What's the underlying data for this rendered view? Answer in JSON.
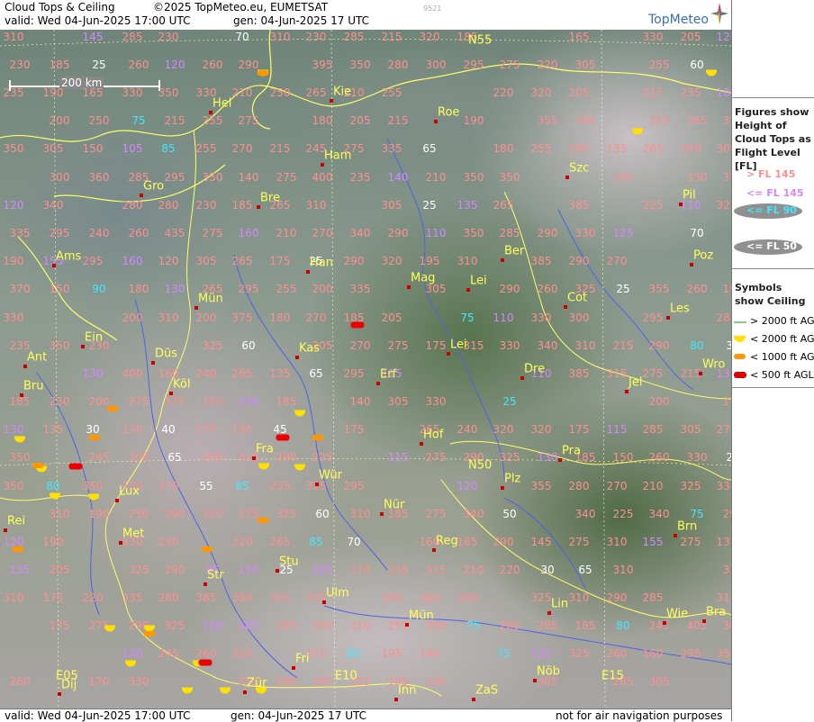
{
  "header": {
    "title": "Cloud Tops & Ceiling",
    "copyright": "©2025 TopMeteo.eu, EUMETSAT",
    "valid": "valid:  Wed  04-Jun-2025  17:00 UTC",
    "gen": "gen: 04-Jun-2025 17 UTC",
    "code": "9521",
    "logo": "TopMeteo"
  },
  "scale_label": "200 km",
  "footer": {
    "valid": "valid:  Wed  04-Jun-2025  17:00 UTC",
    "gen": "gen: 04-Jun-2025 17 UTC",
    "disclaimer": "not for air navigation purposes"
  },
  "legend": {
    "clouds_heading": "Figures show Height of Cloud Tops as Flight Level  [FL]",
    "fl_items": [
      {
        "label": "> FL 145",
        "color": "#ff8f8f",
        "bg": ""
      },
      {
        "label": "<= FL 145",
        "color": "#d586ff",
        "bg": ""
      },
      {
        "label": "<= FL 90",
        "color": "#3fe8ff",
        "bg": "#909090"
      },
      {
        "label": "<= FL 70",
        "color": "#ffffff",
        "bg": ""
      },
      {
        "label": "<= FL 50",
        "color": "#ffffff",
        "bg": "#909090"
      }
    ],
    "symbols_heading": "Symbols show Ceiling",
    "ceiling_items": [
      {
        "label": "> 2000 ft AGL",
        "symbol": "line",
        "color": "#7fd07f"
      },
      {
        "label": "< 2000 ft AGL",
        "symbol": "yellow",
        "color": "#ffe000"
      },
      {
        "label": "< 1000 ft AGL",
        "symbol": "orange",
        "color": "#ff9800"
      },
      {
        "label": "< 500 ft AGL",
        "symbol": "red",
        "color": "#e00000"
      }
    ]
  },
  "grid_labels": [
    "E05",
    "E10",
    "E15",
    "N50",
    "N55"
  ],
  "cities": [
    "Kie",
    "Hel",
    "Ham",
    "Gro",
    "Bre",
    "Ams",
    "Han",
    "Ber",
    "Szc",
    "Pil",
    "Mag",
    "Lei",
    "Poz",
    "Mün",
    "Cot",
    "Les",
    "Ein",
    "Kas",
    "Ant",
    "Düs",
    "Lei",
    "Bru",
    "Köl",
    "Erf",
    "Dre",
    "Wro",
    "Jel",
    "Fra",
    "Hof",
    "Pra",
    "Lux",
    "Wür",
    "Plz",
    "Rei",
    "Met",
    "Nür",
    "Reg",
    "Brn",
    "Stu",
    "Str",
    "Ulm",
    "Lin",
    "Mün",
    "Wie",
    "Bra",
    "Fri",
    "Nöb",
    "Dij",
    "Inn",
    "Zür",
    "ZaS",
    "Roe"
  ],
  "cloud_tops": {
    "pink": [
      "305",
      "325",
      "200",
      "250",
      "185",
      "290",
      "205",
      "255",
      "165",
      "150",
      "310",
      "385",
      "405",
      "265",
      "200",
      "175",
      "180",
      "295",
      "160",
      "250",
      "195",
      "150",
      "175",
      "150",
      "170",
      "275",
      "165",
      "230",
      "195",
      "190",
      "315",
      "265",
      "205",
      "200",
      "235",
      "230",
      "385",
      "435",
      "195",
      "150",
      "135",
      "265",
      "185",
      "225",
      "275",
      "280",
      "290",
      "210",
      "195",
      "190",
      "140",
      "160",
      "200",
      "235",
      "200",
      "220",
      "325",
      "190",
      "185",
      "190",
      "145",
      "245",
      "200",
      "235",
      "320",
      "170",
      "140",
      "185",
      "230",
      "215",
      "185",
      "260",
      "200",
      "195",
      "295",
      "330",
      "235",
      "120",
      "205",
      "245",
      "245",
      "185",
      "105",
      "210",
      "290",
      "260",
      "295",
      "320",
      "275",
      "185",
      "170",
      "235",
      "215",
      "210",
      "260",
      "305",
      "255",
      "305",
      "360",
      "350",
      "245",
      "175",
      "165",
      "170",
      "135",
      "185",
      "205",
      "180",
      "215",
      "270",
      "275",
      "305",
      "290",
      "325",
      "350",
      "200",
      "160",
      "190",
      "255",
      "245",
      "265",
      "270",
      "310",
      "375",
      "350",
      "395",
      "185",
      "210",
      "225",
      "240",
      "265",
      "275",
      "215",
      "210",
      "245",
      "240",
      "260",
      "255",
      "350",
      "350",
      "350",
      "225",
      "270",
      "270",
      "290",
      "260",
      "275",
      "225",
      "285",
      "260",
      "285",
      "310",
      "290",
      "305",
      "305",
      "325",
      "360",
      "350",
      "230",
      "275",
      "280",
      "290",
      "295",
      "260",
      "325",
      "275",
      "295",
      "315",
      "355",
      "385",
      "400",
      "180",
      "230",
      "275",
      "285",
      "290",
      "275",
      "280",
      "295",
      "260",
      "325",
      "275",
      "295",
      "315",
      "355",
      "385",
      "400",
      "230",
      "180",
      "195",
      "265",
      "285",
      "265",
      "290",
      "305",
      "295",
      "215",
      "280",
      "310",
      "310",
      "340",
      "330",
      "235",
      "190",
      "175",
      "255",
      "240",
      "290",
      "265",
      "275",
      "285",
      "290",
      "295",
      "280",
      "290",
      "310",
      "330",
      "330",
      "325",
      "135",
      "185",
      "290",
      "290",
      "290",
      "275",
      "290",
      "310",
      "325",
      "330",
      "310",
      "330",
      "350",
      "350",
      "350",
      "310",
      "175",
      "135",
      "210",
      "295",
      "305",
      "340",
      "320",
      "325",
      "350",
      "310",
      "340",
      "330",
      "350",
      "355",
      "340",
      "265",
      "175",
      "275",
      "215",
      "310",
      "305",
      "300",
      "325",
      "350",
      "310",
      "305",
      "355",
      "330",
      "375",
      "370",
      "220",
      "205",
      "205",
      "280",
      "215",
      "310",
      "275",
      "350",
      "375",
      "340",
      "325",
      "320",
      "320",
      "335",
      "330",
      "255",
      "220",
      "270",
      "235",
      "315",
      "285",
      "265",
      "305",
      "340",
      "325",
      "320",
      "335",
      "330",
      "310",
      "350",
      "330",
      "220",
      "255",
      "260",
      "225",
      "280",
      "350",
      "310",
      "275",
      "330",
      "310",
      "330",
      "330",
      "335",
      "300",
      "185",
      "250",
      "255",
      "285",
      "260",
      "270",
      "270",
      "285",
      "290",
      "265",
      "335",
      "300",
      "300"
    ],
    "violet": [
      "105",
      "135",
      "95",
      "130",
      "120",
      "110",
      "115",
      "120",
      "110",
      "100",
      "135",
      "135",
      "130",
      "110",
      "155",
      "110",
      "115",
      "135",
      "160",
      "155",
      "160",
      "145",
      "120",
      "130",
      "115",
      "130",
      "120",
      "130",
      "140",
      "130",
      "105",
      "165",
      "130",
      "125",
      "120",
      "135"
    ],
    "cyan": [
      "25",
      "75",
      "90",
      "80",
      "80",
      "85",
      "85",
      "85",
      "85",
      "80",
      "75",
      "75",
      "75",
      "75"
    ],
    "white": [
      "25",
      "25",
      "25",
      "60",
      "65",
      "65",
      "65",
      "60",
      "35",
      "45",
      "70",
      "70",
      "70",
      "60",
      "65",
      "50",
      "25",
      "25",
      "30",
      "25",
      "30",
      "40",
      "55"
    ]
  }
}
